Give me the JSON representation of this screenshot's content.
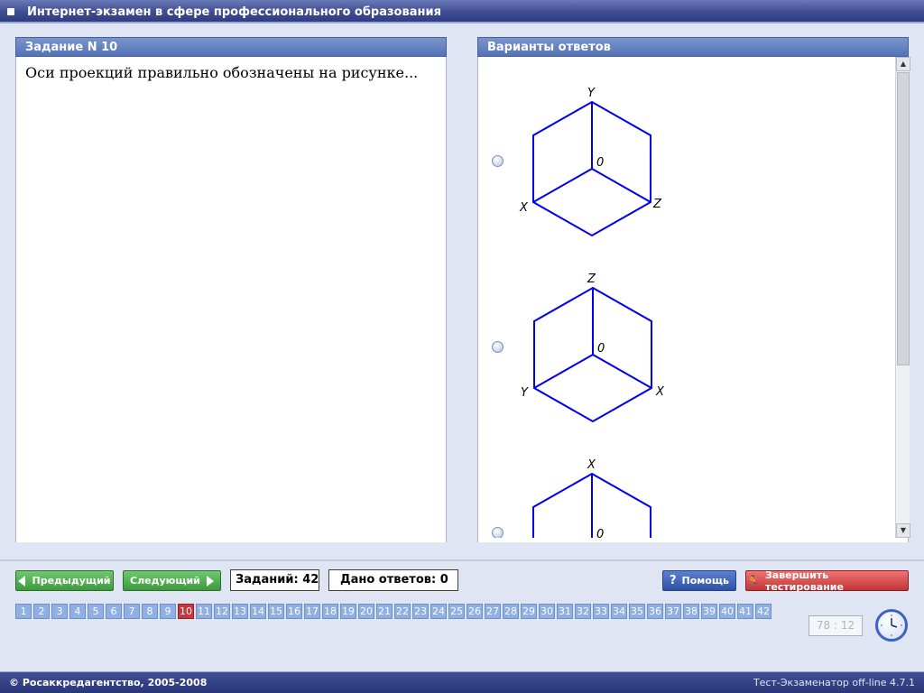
{
  "window": {
    "title": "Интернет-экзамен в сфере профессионального образования"
  },
  "question_panel": {
    "header": "Задание N 10",
    "text": "Оси проекций правильно обозначены на рисунке..."
  },
  "answers_panel": {
    "header": "Варианты ответов",
    "options": [
      {
        "labels": {
          "top": "Y",
          "center": "0",
          "left": "X",
          "right": "Z"
        }
      },
      {
        "labels": {
          "top": "Z",
          "center": "0",
          "left": "Y",
          "right": "X"
        }
      },
      {
        "labels": {
          "top": "X",
          "center": "0",
          "left": "",
          "right": ""
        }
      }
    ]
  },
  "nav": {
    "prev_label": "Предыдущий",
    "next_label": "Следующий",
    "tasks_count_label": "Заданий: 42",
    "answered_label": "Дано ответов: 0",
    "help_label": "Помощь",
    "finish_label": "Завершить тестирование"
  },
  "pages": {
    "current": 10,
    "items": [
      "1",
      "2",
      "3",
      "4",
      "5",
      "6",
      "7",
      "8",
      "9",
      "10",
      "11",
      "12",
      "13",
      "14",
      "15",
      "16",
      "17",
      "18",
      "19",
      "20",
      "21",
      "22",
      "23",
      "24",
      "25",
      "26",
      "27",
      "28",
      "29",
      "30",
      "31",
      "32",
      "33",
      "34",
      "35",
      "36",
      "37",
      "38",
      "39",
      "40",
      "41",
      "42"
    ]
  },
  "timer": {
    "value": "78 : 12"
  },
  "footer": {
    "copyright": "© Росаккредагентство, 2005-2008",
    "version": "Тест-Экзаменатор off-line 4.7.1"
  },
  "colors": {
    "axis_lines": "#0000ee",
    "active_page": "#c8373a",
    "page": "#8fb0e4"
  }
}
